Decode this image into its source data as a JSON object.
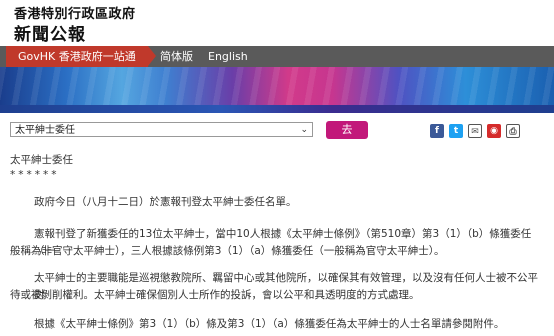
{
  "header": {
    "line1": "香港特別行政區政府",
    "line2": "新聞公報"
  },
  "nav": {
    "govhk": "GovHK 香港政府一站通",
    "simplified": "简体版",
    "english": "English"
  },
  "search": {
    "selected": "太平紳士委任",
    "go_label": "去"
  },
  "social_icons": [
    "facebook-icon",
    "twitter-icon",
    "email-icon",
    "weibo-icon",
    "print-icon"
  ],
  "colors": {
    "brand_red": "#c0392b",
    "go_button": "#c2187a",
    "nav_bg": "#5a5a5a"
  },
  "article": {
    "title": "太平紳士委任",
    "stars": "******",
    "p1": "政府今日（八月十二日）於憲報刊登太平紳士委任名單。",
    "p2a": "憲報刊登了新獲委任的13位太平紳士，當中10人根據《太平紳士條例》（第510章）第3（1）（b）條獲委任（一",
    "p2b": "般稱為非官守太平紳士），三人根據該條例第3（1）（a）條獲委任（一般稱為官守太平紳士）。",
    "p3a": "太平紳士的主要職能是巡視懲教院所、羈留中心或其他院所，以確保其有效管理，以及沒有任何人士被不公平對",
    "p3b": "待或被剝削權利。太平紳士確保個別人士所作的投訴，會以公平和具透明度的方式處理。",
    "p4": "根據《太平紳士條例》第3（1）（b）條及第3（1）（a）條獲委任為太平紳士的人士名單請參閱附件。"
  }
}
